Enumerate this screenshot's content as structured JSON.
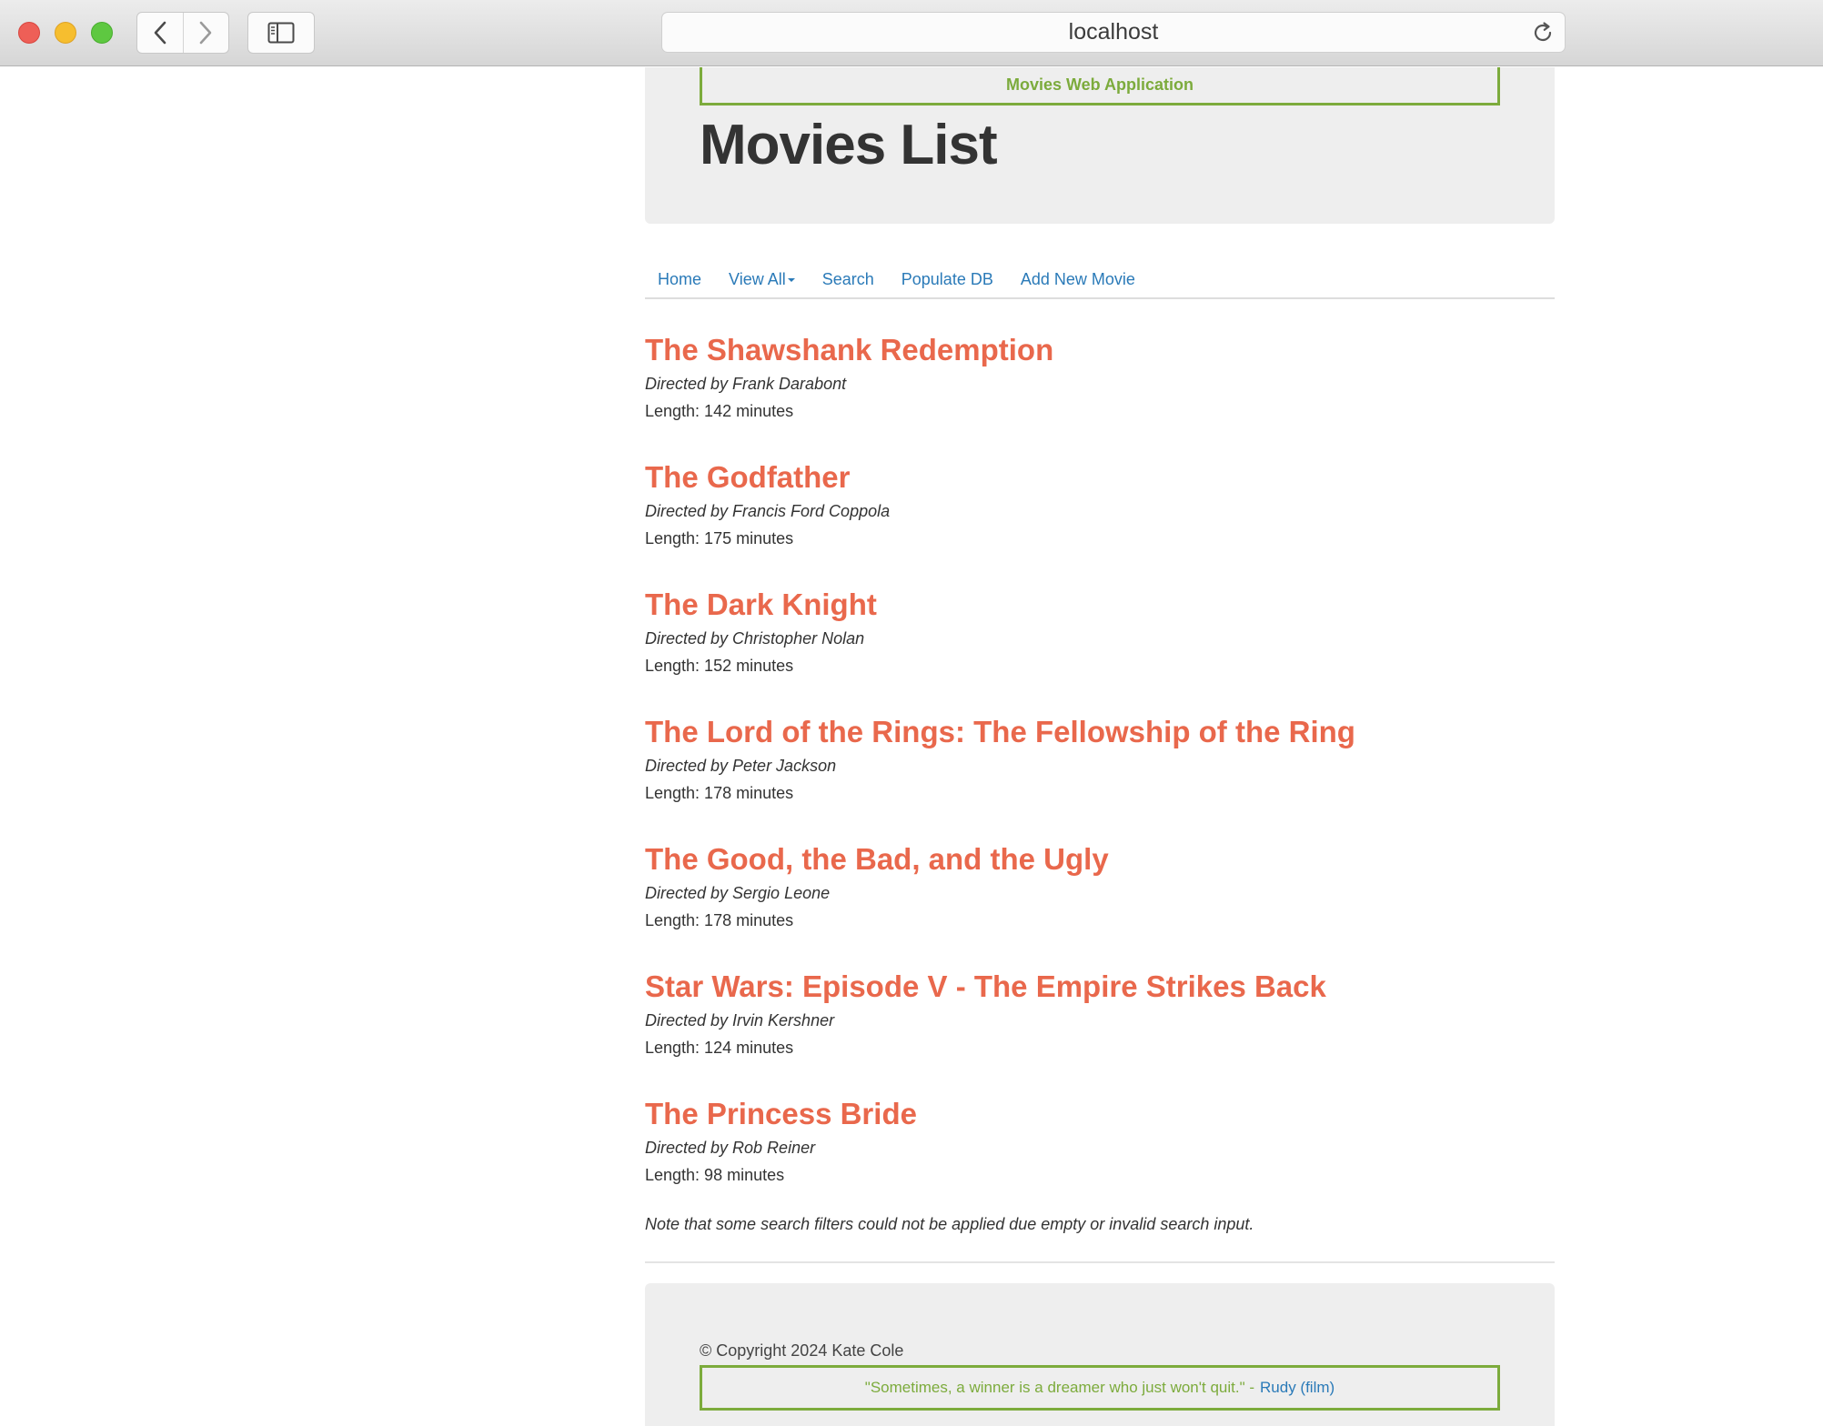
{
  "browser": {
    "url": "localhost"
  },
  "header": {
    "app_name": "Movies Web Application",
    "title": "Movies List"
  },
  "nav": {
    "items": [
      {
        "label": "Home"
      },
      {
        "label": "View All",
        "has_dropdown": true
      },
      {
        "label": "Search"
      },
      {
        "label": "Populate DB"
      },
      {
        "label": "Add New Movie"
      }
    ]
  },
  "movies": [
    {
      "title": "The Shawshank Redemption",
      "director": "Directed by Frank Darabont",
      "length": "Length: 142 minutes"
    },
    {
      "title": "The Godfather",
      "director": "Directed by Francis Ford Coppola",
      "length": "Length: 175 minutes"
    },
    {
      "title": "The Dark Knight",
      "director": "Directed by Christopher Nolan",
      "length": "Length: 152 minutes"
    },
    {
      "title": "The Lord of the Rings: The Fellowship of the Ring",
      "director": "Directed by Peter Jackson",
      "length": "Length: 178 minutes"
    },
    {
      "title": "The Good, the Bad, and the Ugly",
      "director": "Directed by Sergio Leone",
      "length": "Length: 178 minutes"
    },
    {
      "title": "Star Wars: Episode V - The Empire Strikes Back",
      "director": "Directed by Irvin Kershner",
      "length": "Length: 124 minutes"
    },
    {
      "title": "The Princess Bride",
      "director": "Directed by Rob Reiner",
      "length": "Length: 98 minutes"
    }
  ],
  "note": "Note that some search filters could not be applied due empty or invalid search input.",
  "footer": {
    "copyright": "© Copyright 2024 Kate Cole",
    "quote": "\"Sometimes, a winner is a dreamer who just won't quit.\" -",
    "quote_source": "Rudy (film)"
  },
  "colors": {
    "accent_green": "#7cab3c",
    "movie_title": "#e9684c",
    "link_blue": "#2a7ab8"
  }
}
